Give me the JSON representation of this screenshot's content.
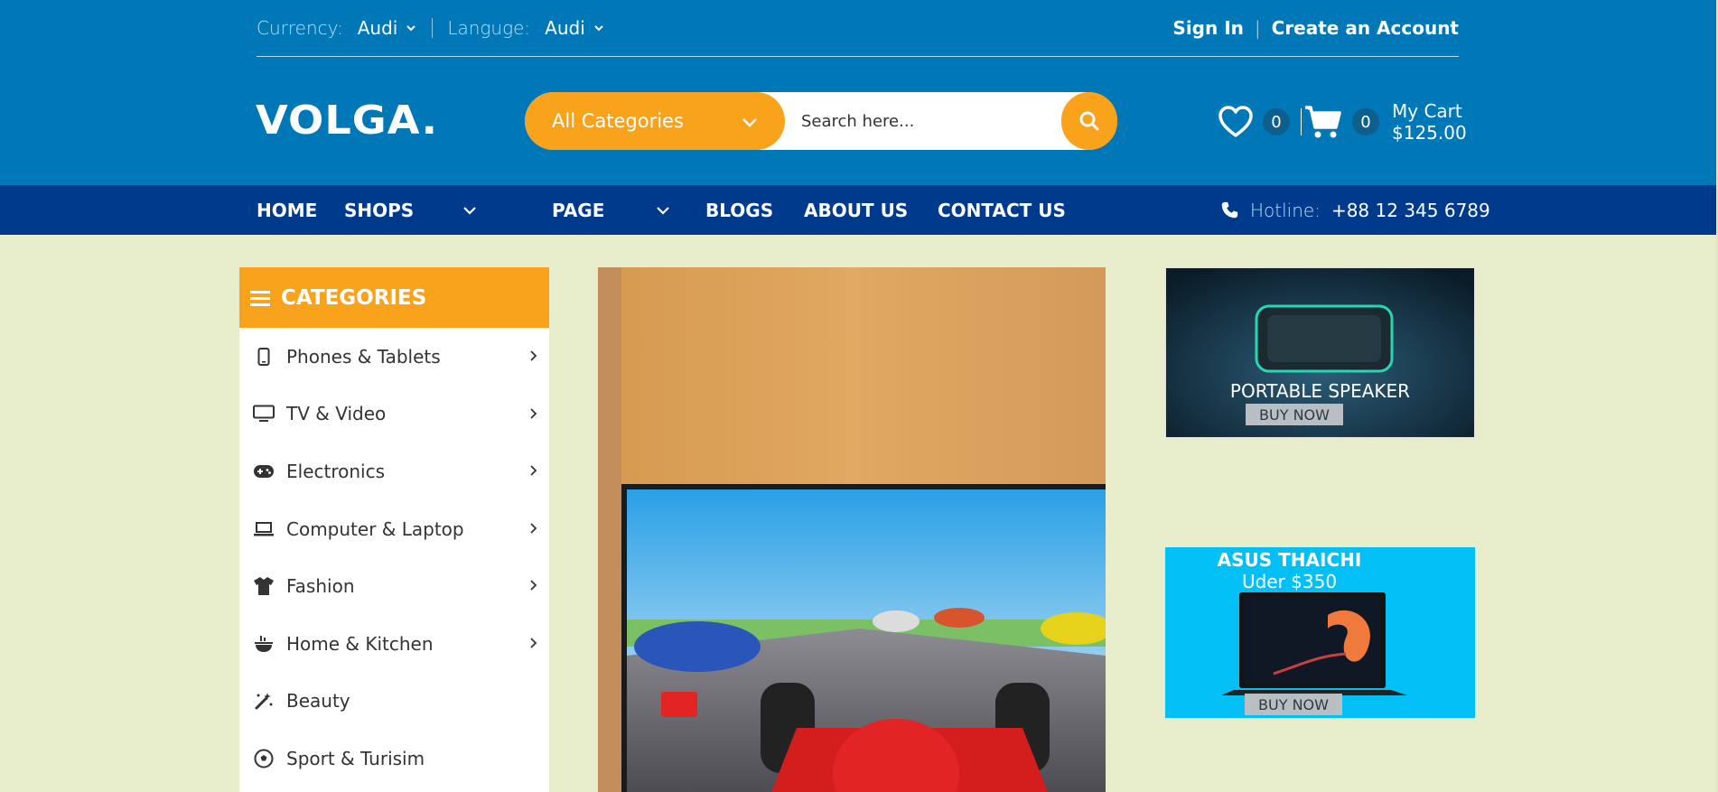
{
  "top_bar": {
    "currency_label": "Currency:",
    "currency_value": "Audi",
    "language_label": "Languge:",
    "language_value": "Audi",
    "sign_in": "Sign In",
    "divider": "|",
    "create_account": "Create an Account"
  },
  "brand": {
    "logo": "VOLGA."
  },
  "search": {
    "category_label": "All Categories",
    "placeholder": "Search here..."
  },
  "header_icons": {
    "wishlist_count": "0",
    "cart_count": "0",
    "cart_label": "My Cart",
    "cart_total": "$125.00"
  },
  "nav": {
    "items": [
      "HOME",
      "SHOPS",
      "PAGE",
      "BLOGS",
      "ABOUT US",
      "CONTACT US"
    ],
    "hotline_label": "Hotline:",
    "hotline_number": "+88 12 345 6789"
  },
  "categories": {
    "title": "CATEGORIES",
    "items": [
      {
        "label": "Phones & Tablets",
        "icon": "phone-icon",
        "has_submenu": true
      },
      {
        "label": "TV & Video",
        "icon": "tv-icon",
        "has_submenu": true
      },
      {
        "label": "Electronics",
        "icon": "gamepad-icon",
        "has_submenu": true
      },
      {
        "label": "Computer & Laptop",
        "icon": "laptop-icon",
        "has_submenu": true
      },
      {
        "label": "Fashion",
        "icon": "tshirt-icon",
        "has_submenu": true
      },
      {
        "label": "Home & Kitchen",
        "icon": "kitchen-icon",
        "has_submenu": true
      },
      {
        "label": "Beauty",
        "icon": "magic-wand-icon",
        "has_submenu": false
      },
      {
        "label": "Sport & Turisim",
        "icon": "soccer-ball-icon",
        "has_submenu": false
      }
    ]
  },
  "promos": [
    {
      "title": "PORTABLE SPEAKER",
      "button": "BUY NOW"
    },
    {
      "title_line1": "ASUS THAICHI",
      "title_line2": "Uder $350",
      "button": "BUY NOW"
    }
  ],
  "colors": {
    "header_blue": "#0077b6",
    "nav_navy": "#003a8c",
    "accent_orange": "#f9a21b",
    "page_bg": "#e7ecca",
    "promo_cyan": "#02c0f5"
  }
}
